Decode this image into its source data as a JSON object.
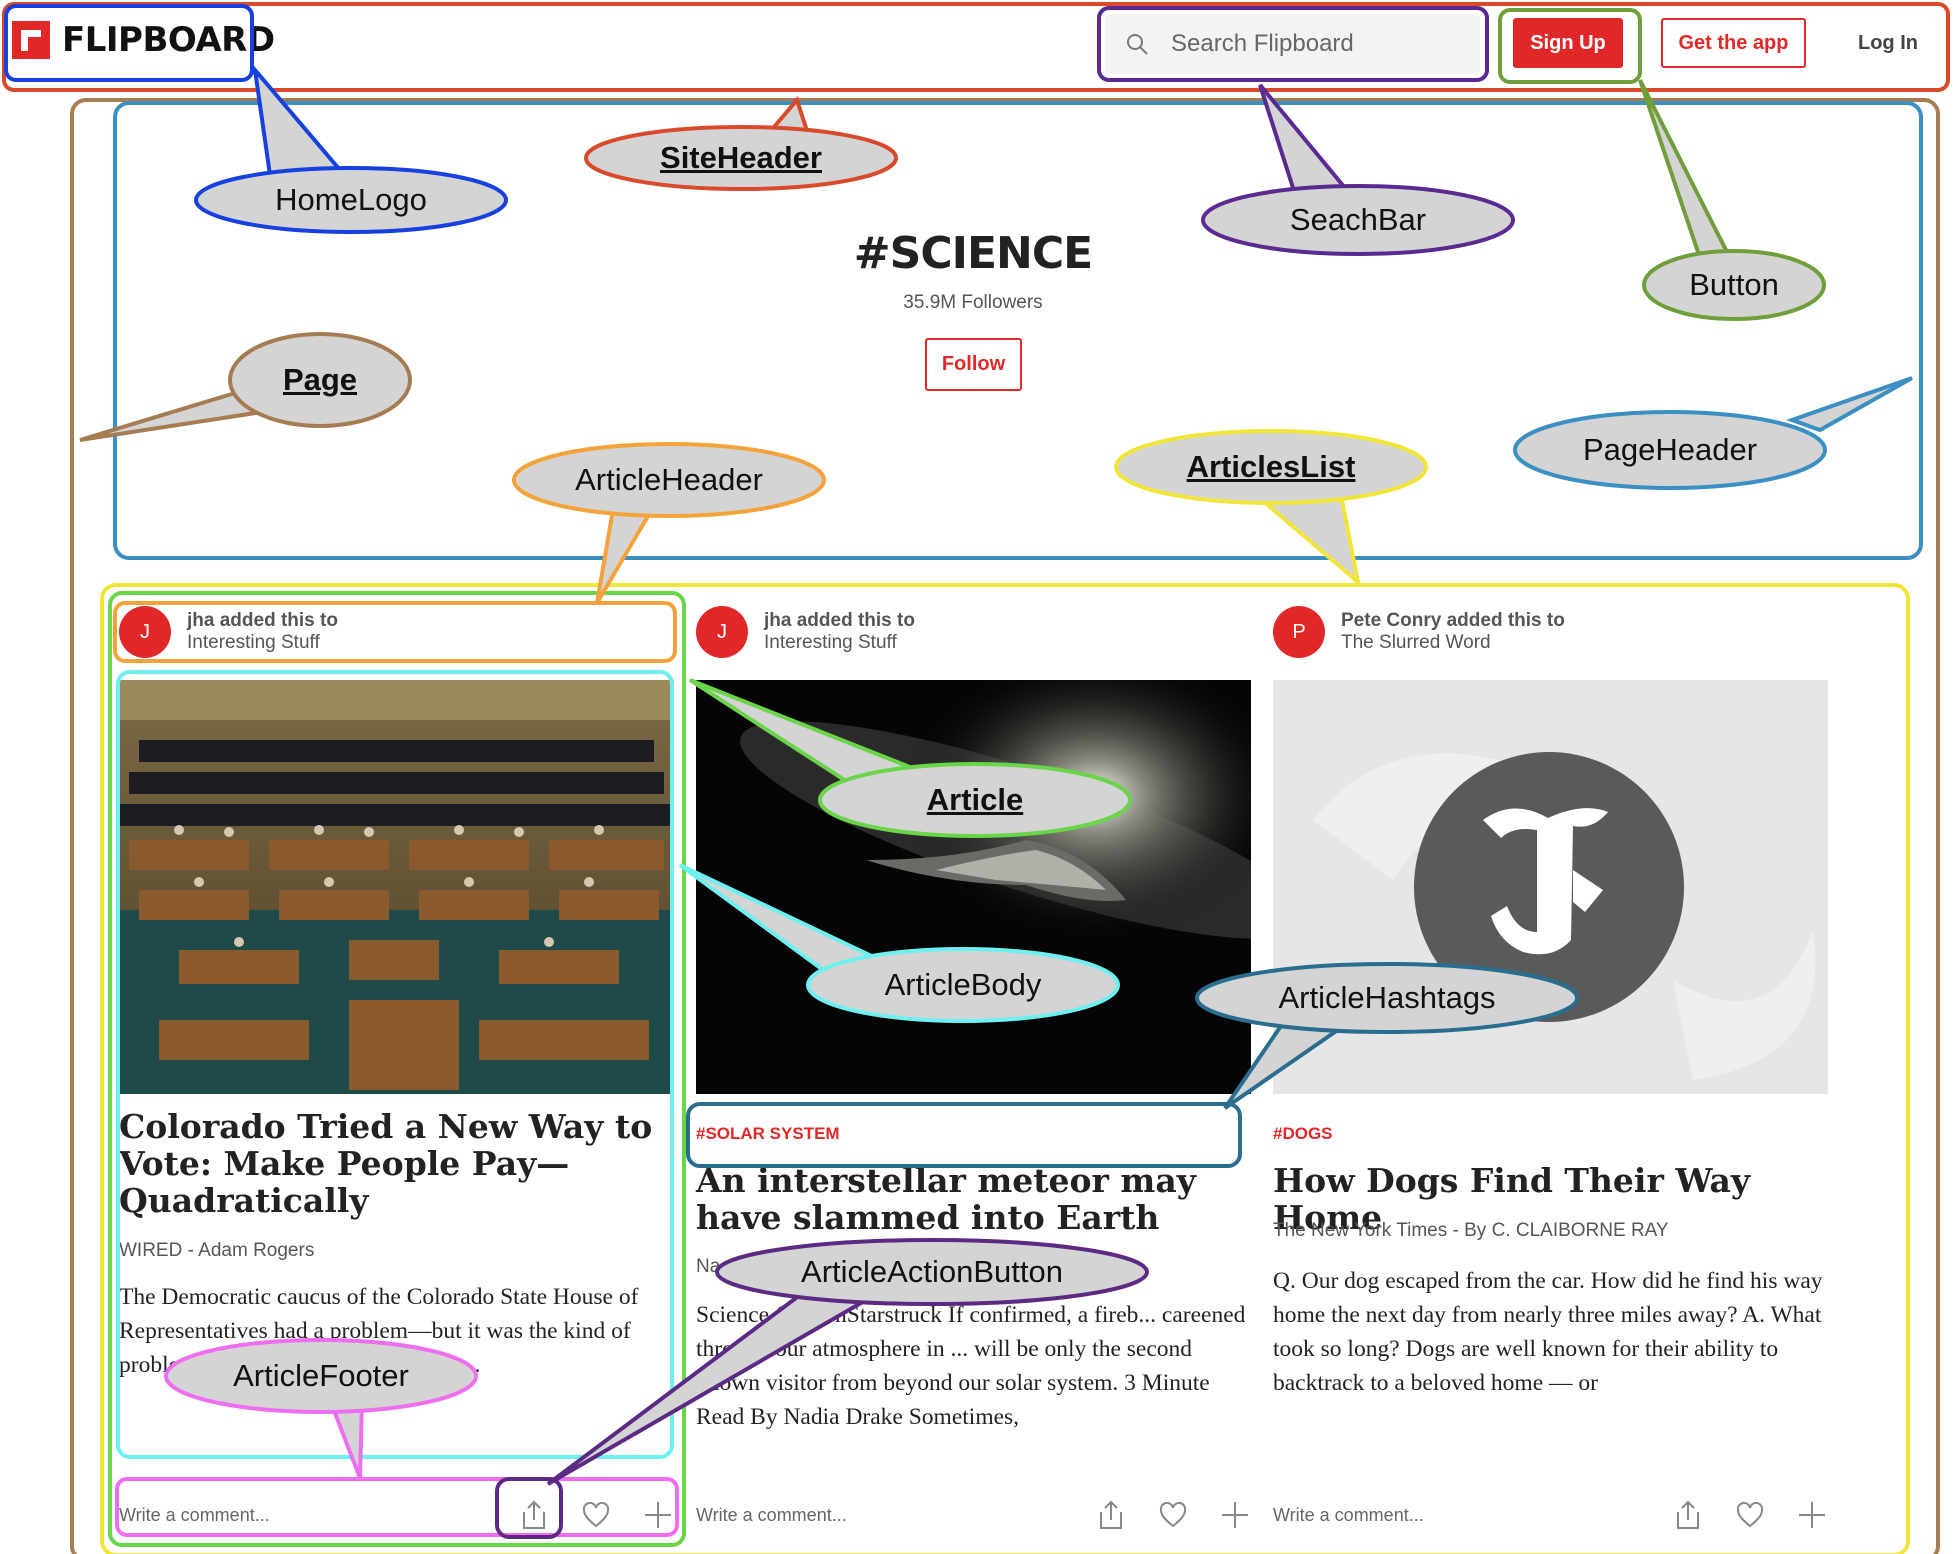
{
  "header": {
    "logo_text": "FLIPBOARD",
    "search_placeholder": "Search Flipboard",
    "signup_label": "Sign Up",
    "get_app_label": "Get the app",
    "login_label": "Log In"
  },
  "page": {
    "title": "#SCIENCE",
    "followers": "35.9M Followers",
    "follow_label": "Follow"
  },
  "articles": [
    {
      "avatar": "J",
      "user": "jha",
      "added_text": "added this to",
      "magazine": "Interesting Stuff",
      "hashtag": "",
      "headline": "Colorado Tried a New Way to Vote: Make People Pay—Quadratically",
      "byline": "WIRED - Adam Rogers",
      "excerpt": "The Democratic caucus of the Colorado State House of Representatives had a problem—but it was the kind of problem... election put Democrats in...",
      "comment_placeholder": "Write a comment..."
    },
    {
      "avatar": "J",
      "user": "jha",
      "added_text": "added this to",
      "magazine": "Interesting Stuff",
      "hashtag": "#SOLAR SYSTEM",
      "headline": "An interstellar meteor may have slammed into Earth",
      "byline": "Na...",
      "excerpt": "Science & ...ionStarstruck If confirmed, a fireb... careened through our atmosphere in ... will be only the second known visitor from beyond our solar system. 3 Minute Read By Nadia Drake Sometimes,",
      "comment_placeholder": "Write a comment..."
    },
    {
      "avatar": "P",
      "user": "Pete Conry",
      "added_text": "added this to",
      "magazine": "The Slurred Word",
      "hashtag": "#DOGS",
      "headline": "How Dogs Find Their Way Home",
      "byline": "The New York Times - By C. CLAIBORNE RAY",
      "excerpt": "Q. Our dog escaped from the car. How did he find his way home the next day from nearly three miles away? A. What took so long? Dogs are well known for their ability to backtrack to a beloved home — or",
      "comment_placeholder": "Write a comment..."
    }
  ],
  "annotations": {
    "site_header": "SiteHeader",
    "home_logo": "HomeLogo",
    "search_bar": "SeachBar",
    "button": "Button",
    "page": "Page",
    "page_header": "PageHeader",
    "article_header": "ArticleHeader",
    "articles_list": "ArticlesList",
    "article": "Article",
    "article_body": "ArticleBody",
    "article_hashtags": "ArticleHashtags",
    "article_action_button": "ArticleActionButton",
    "article_footer": "ArticleFooter"
  },
  "colors": {
    "brand": "#e12828",
    "site_header": "#d94a2b",
    "home_logo": "#1640e0",
    "search_bar": "#5a2a91",
    "button": "#6f9e3a",
    "page": "#a67c52",
    "page_header": "#3b8fc2",
    "article_header": "#f4a23a",
    "articles_list": "#f2e53a",
    "article": "#6ad44a",
    "article_body": "#6ef0f0",
    "article_hashtags": "#2a6d8f",
    "article_action_button": "#5c2a82",
    "article_footer": "#ee6ef0",
    "bubble_fill": "#d4d4d4"
  }
}
